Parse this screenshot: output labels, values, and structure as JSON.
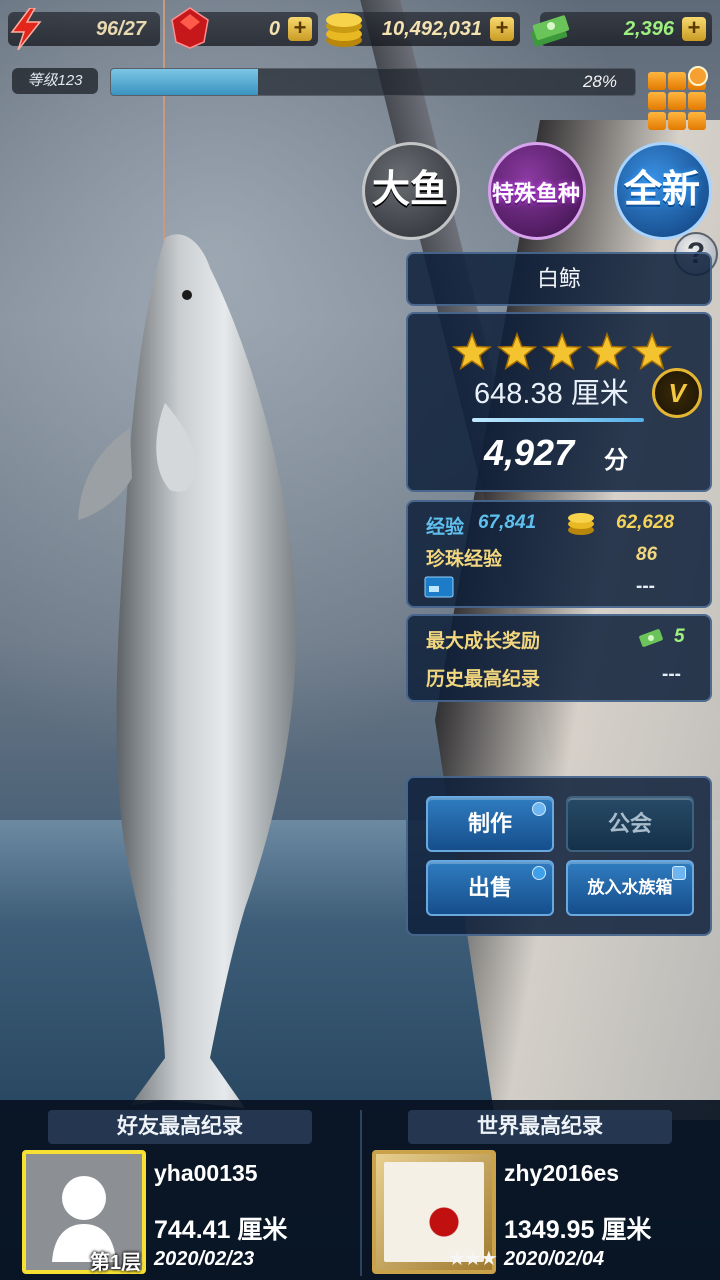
{
  "resources": {
    "energy": "96/27",
    "gems": "0",
    "coins": "10,492,031",
    "cash": "2,396"
  },
  "level": {
    "label": "等级123",
    "progress_label": "28%",
    "progress": 0.28
  },
  "badges": {
    "big_fish": "大鱼",
    "special": "特殊鱼种",
    "new": "全新"
  },
  "fish": {
    "name": "白鲸",
    "stars": 5,
    "size": "648.38 厘米",
    "rank_badge": "V",
    "score": "4,927",
    "score_unit": "分"
  },
  "stats": {
    "exp_label": "经验",
    "exp_value": "67,841",
    "coin_value": "62,628",
    "pearl_exp_label": "珍珠经验",
    "pearl_exp_value": "86",
    "card_value": "---"
  },
  "rewards": {
    "max_growth_label": "最大成长奖励",
    "max_growth_value": "5",
    "history_label": "历史最高纪录",
    "history_value": "---"
  },
  "actions": {
    "craft": "制作",
    "guild": "公会",
    "sell": "出售",
    "aquarium": "放入水族箱"
  },
  "records": {
    "friend": {
      "title": "好友最高纪录",
      "user": "yha00135",
      "size": "744.41 厘米",
      "date": "2020/02/23",
      "rank": "第1层"
    },
    "world": {
      "title": "世界最高纪录",
      "user": "zhy2016es",
      "size": "1349.95 厘米",
      "date": "2020/02/04"
    }
  },
  "colors": {
    "panel_bg": "#0e203a",
    "accent_gold": "#f4c430",
    "exp_blue": "#5fc0ee",
    "button_blue": "#2f7cc0"
  }
}
